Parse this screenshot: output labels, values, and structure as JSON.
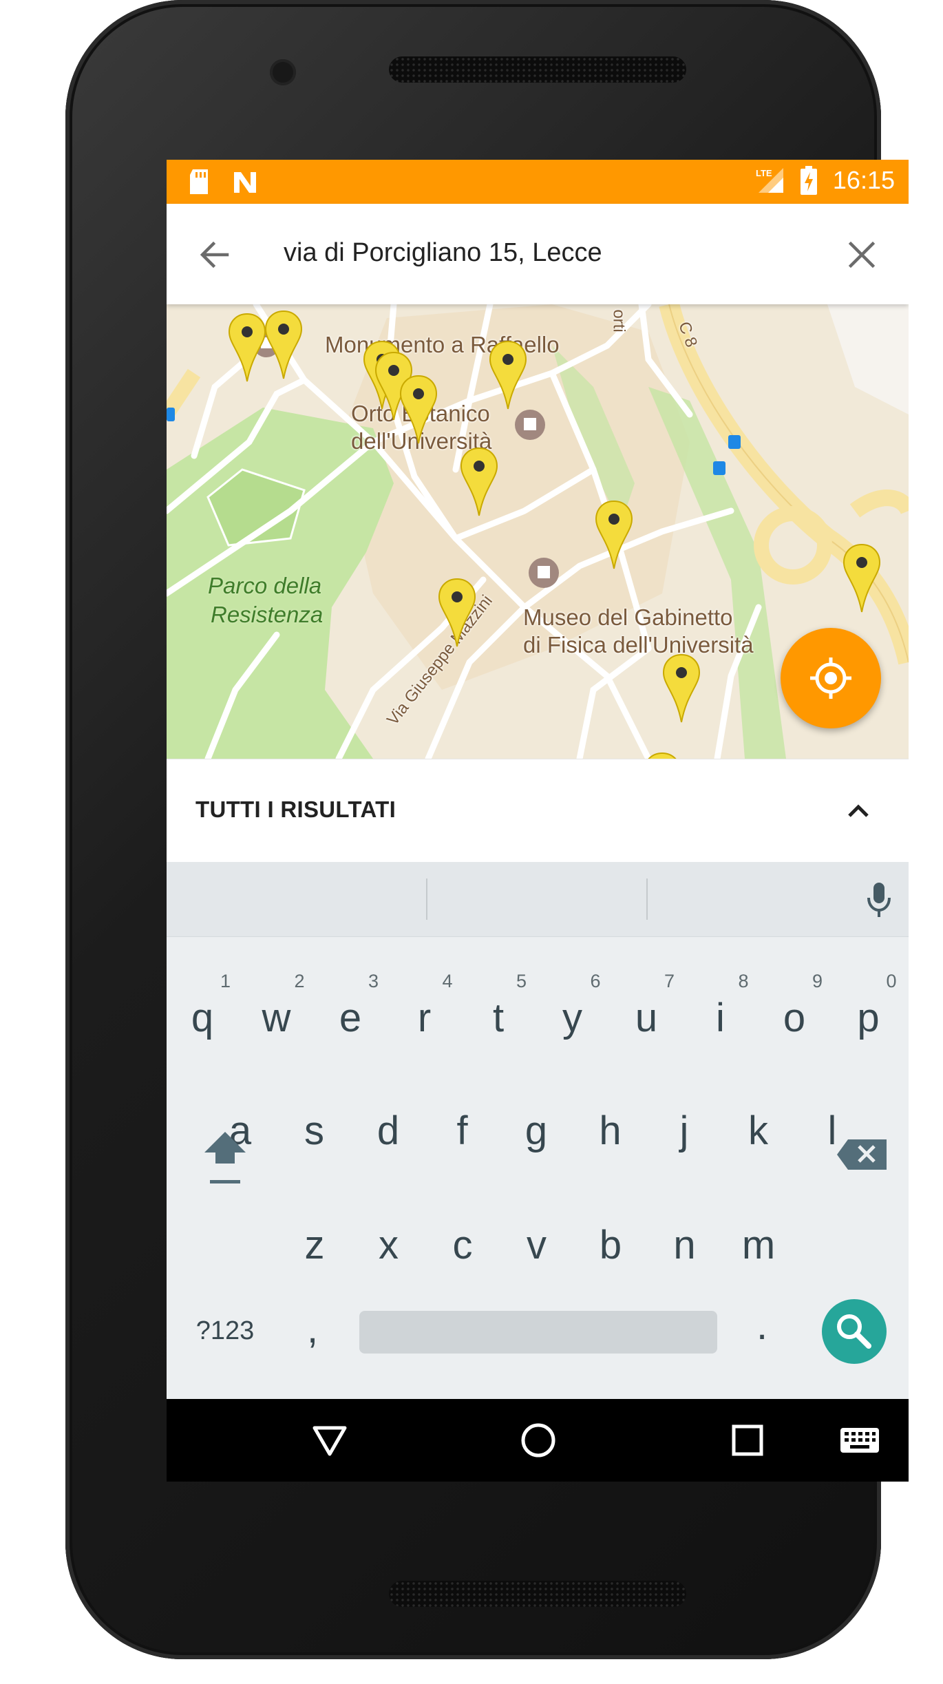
{
  "statusbar": {
    "time": "16:15",
    "network": "LTE",
    "icons": [
      "sd-card-icon",
      "n-icon",
      "lte-signal-icon",
      "battery-charging-icon"
    ]
  },
  "search": {
    "query": "via di Porcigliano 15, Lecce"
  },
  "map": {
    "labels": {
      "monument": "Monumento a Raffaello",
      "garden_line1": "Orto Botanico",
      "garden_line2": "dell'Università",
      "park_line1": "Parco della",
      "park_line2": "Resistenza",
      "museum_line1": "Museo del Gabinetto",
      "museum_line2": "di Fisica dell'Università",
      "street": "Via Giuseppe Mazzini",
      "road_c8": "C 8",
      "road_top": "orti"
    },
    "pin_color": "#f4dc3c"
  },
  "results": {
    "title": "TUTTI I RISULTATI"
  },
  "keyboard": {
    "row1": [
      "q",
      "w",
      "e",
      "r",
      "t",
      "y",
      "u",
      "i",
      "o",
      "p"
    ],
    "row1_hints": [
      "1",
      "2",
      "3",
      "4",
      "5",
      "6",
      "7",
      "8",
      "9",
      "0"
    ],
    "row2": [
      "a",
      "s",
      "d",
      "f",
      "g",
      "h",
      "j",
      "k",
      "l"
    ],
    "row3": [
      "z",
      "x",
      "c",
      "v",
      "b",
      "n",
      "m"
    ],
    "symbols_label": "?123",
    "comma": ",",
    "period": "."
  },
  "colors": {
    "accent": "#ff9800",
    "search_key": "#26a69a",
    "keyboard_bg": "#eceff1"
  }
}
